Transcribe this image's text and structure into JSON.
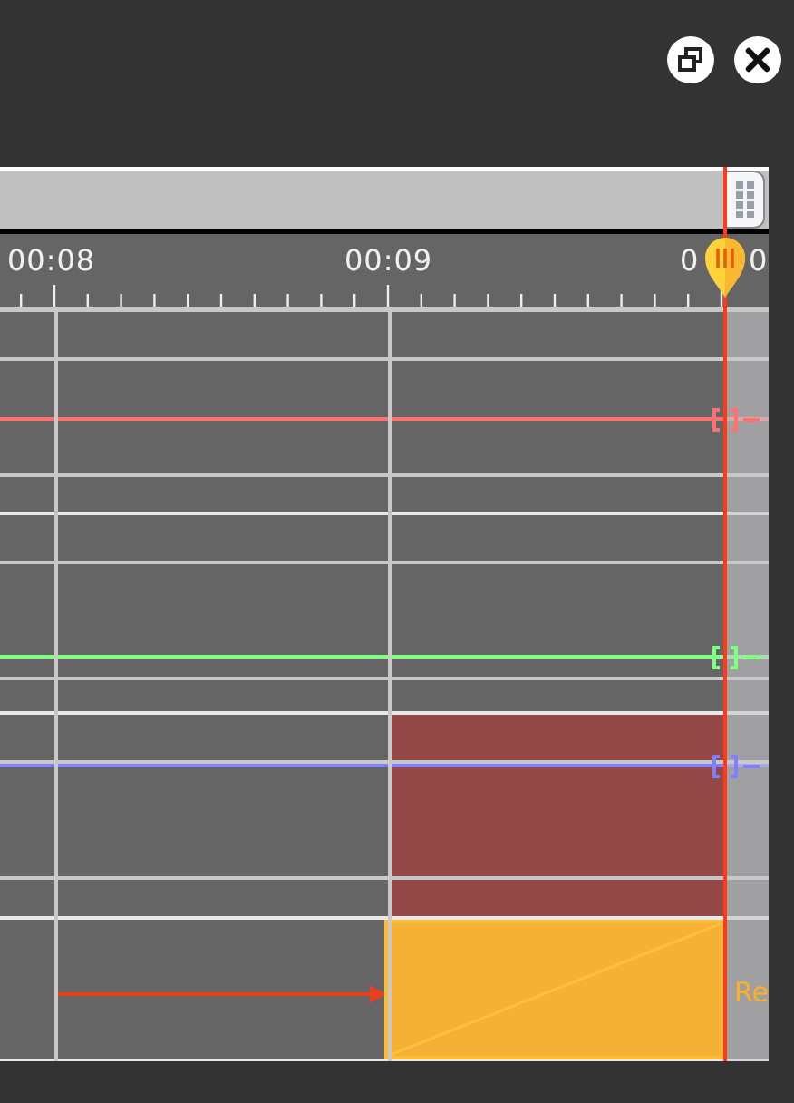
{
  "window_controls": [
    {
      "kind": "restore"
    },
    {
      "kind": "close"
    }
  ],
  "ruler": {
    "labels": [
      {
        "text": "00:08"
      },
      {
        "text": "00:09"
      },
      {
        "text": "0"
      },
      {
        "text": "0"
      }
    ]
  },
  "tracks": [
    {
      "kind": "automation",
      "color": "#ff7070"
    },
    {
      "kind": "automation",
      "color": "#80ff80"
    },
    {
      "kind": "automation",
      "color": "#8080ff",
      "region": true
    },
    {
      "kind": "clip",
      "label": "Re"
    }
  ]
}
